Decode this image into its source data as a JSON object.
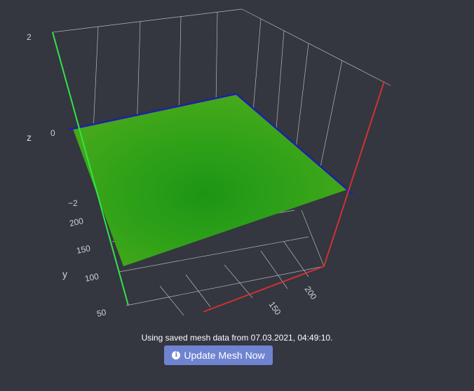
{
  "plot": {
    "axes": {
      "z": {
        "title": "z",
        "ticks": [
          "2",
          "0",
          "−2"
        ]
      },
      "y": {
        "title": "y",
        "ticks": [
          "200",
          "150",
          "100",
          "50"
        ]
      },
      "x": {
        "title": "",
        "ticks": [
          "200",
          "150"
        ]
      }
    },
    "surface_colors": {
      "base": "#3aa316",
      "center": "#1f9a16"
    },
    "axis_colors": {
      "x": "#d03232",
      "y": "#35e24a",
      "z_edge": "#2020a8",
      "grid": "#cfcfcf"
    }
  },
  "status": {
    "text": "Using saved mesh data from 07.03.2021, 04:49:10."
  },
  "update_button": {
    "label": "Update Mesh Now",
    "icon": "info-circle-icon"
  }
}
